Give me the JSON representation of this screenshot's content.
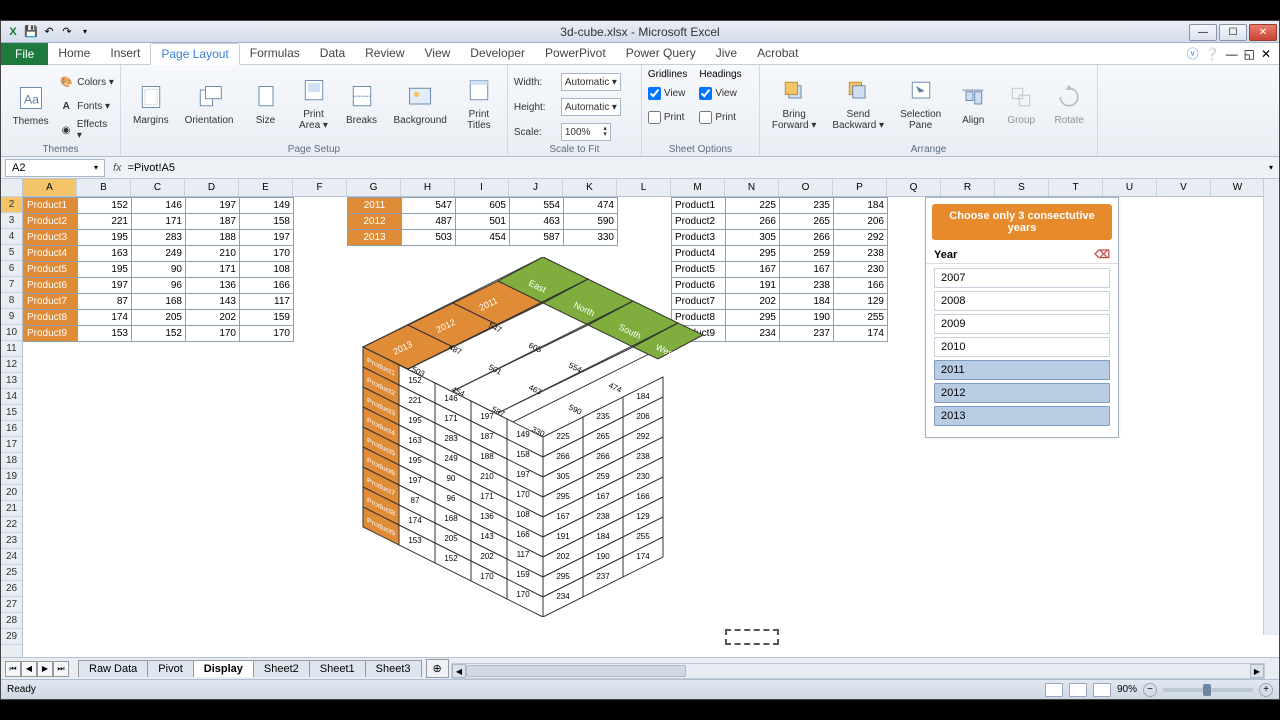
{
  "title": "3d-cube.xlsx - Microsoft Excel",
  "qat": {
    "save": "💾",
    "undo": "↶",
    "redo": "↷"
  },
  "menu": {
    "file": "File",
    "tabs": [
      "Home",
      "Insert",
      "Page Layout",
      "Formulas",
      "Data",
      "Review",
      "View",
      "Developer",
      "PowerPivot",
      "Power Query",
      "Jive",
      "Acrobat"
    ],
    "active": 2
  },
  "ribbon": {
    "themes": {
      "label": "Themes",
      "themes": "Themes",
      "colors": "Colors ▾",
      "fonts": "Fonts ▾",
      "effects": "Effects ▾"
    },
    "pagesetup": {
      "label": "Page Setup",
      "margins": "Margins",
      "orientation": "Orientation",
      "size": "Size",
      "printarea": "Print\nArea ▾",
      "breaks": "Breaks",
      "background": "Background",
      "printtitles": "Print\nTitles"
    },
    "scale": {
      "label": "Scale to Fit",
      "width": "Width:",
      "height": "Height:",
      "scale": "Scale:",
      "auto": "Automatic",
      "pct": "100%"
    },
    "sheetopts": {
      "label": "Sheet Options",
      "gridlines": "Gridlines",
      "headings": "Headings",
      "view": "View",
      "print": "Print",
      "g_view": true,
      "g_print": false,
      "h_view": true,
      "h_print": false
    },
    "arrange": {
      "label": "Arrange",
      "fwd": "Bring\nForward ▾",
      "back": "Send\nBackward ▾",
      "pane": "Selection\nPane",
      "align": "Align",
      "group": "Group",
      "rotate": "Rotate"
    }
  },
  "namebox": "A2",
  "formula": "=Pivot!A5",
  "columns": [
    "A",
    "B",
    "C",
    "D",
    "E",
    "F",
    "G",
    "H",
    "I",
    "J",
    "K",
    "L",
    "M",
    "N",
    "O",
    "P",
    "Q",
    "R",
    "S",
    "T",
    "U",
    "V",
    "W"
  ],
  "rows": [
    "2",
    "3",
    "4",
    "5",
    "6",
    "7",
    "8",
    "9",
    "10",
    "11",
    "12",
    "13",
    "14",
    "15",
    "16",
    "17",
    "18",
    "19",
    "20",
    "21",
    "22",
    "23",
    "24",
    "25",
    "26",
    "27",
    "28",
    "29"
  ],
  "table1": {
    "rows": [
      {
        "p": "Product1",
        "v": [
          152,
          146,
          197,
          149
        ]
      },
      {
        "p": "Product2",
        "v": [
          221,
          171,
          187,
          158
        ]
      },
      {
        "p": "Product3",
        "v": [
          195,
          283,
          188,
          197
        ]
      },
      {
        "p": "Product4",
        "v": [
          163,
          249,
          210,
          170
        ]
      },
      {
        "p": "Product5",
        "v": [
          195,
          90,
          171,
          108
        ]
      },
      {
        "p": "Product6",
        "v": [
          197,
          96,
          136,
          166
        ]
      },
      {
        "p": "Product7",
        "v": [
          87,
          168,
          143,
          117
        ]
      },
      {
        "p": "Product8",
        "v": [
          174,
          205,
          202,
          159
        ]
      },
      {
        "p": "Product9",
        "v": [
          153,
          152,
          170,
          170
        ]
      }
    ]
  },
  "table2": {
    "rows": [
      {
        "y": "2011",
        "v": [
          547,
          605,
          554,
          474
        ]
      },
      {
        "y": "2012",
        "v": [
          487,
          501,
          463,
          590
        ]
      },
      {
        "y": "2013",
        "v": [
          503,
          454,
          587,
          330
        ]
      }
    ]
  },
  "table3": {
    "rows": [
      {
        "p": "Product1",
        "v": [
          225,
          235,
          184
        ]
      },
      {
        "p": "Product2",
        "v": [
          266,
          265,
          206
        ]
      },
      {
        "p": "Product3",
        "v": [
          305,
          266,
          292
        ]
      },
      {
        "p": "Product4",
        "v": [
          295,
          259,
          238
        ]
      },
      {
        "p": "Product5",
        "v": [
          167,
          167,
          230
        ]
      },
      {
        "p": "Product6",
        "v": [
          191,
          238,
          166
        ]
      },
      {
        "p": "Product7",
        "v": [
          202,
          184,
          129
        ]
      },
      {
        "p": "Product8",
        "v": [
          295,
          190,
          255
        ]
      },
      {
        "p": "Product9",
        "v": [
          234,
          237,
          174
        ]
      }
    ]
  },
  "slicer": {
    "banner": "Choose only 3 consectutive years",
    "title": "Year",
    "items": [
      {
        "y": "2007",
        "sel": false
      },
      {
        "y": "2008",
        "sel": false
      },
      {
        "y": "2009",
        "sel": false
      },
      {
        "y": "2010",
        "sel": false
      },
      {
        "y": "2011",
        "sel": true
      },
      {
        "y": "2012",
        "sel": true
      },
      {
        "y": "2013",
        "sel": true
      }
    ]
  },
  "cube_years": [
    "2011",
    "2012",
    "2013"
  ],
  "cube_regions": [
    "East",
    "North",
    "South",
    "West"
  ],
  "sheets": {
    "tabs": [
      "Raw Data",
      "Pivot",
      "Display",
      "Sheet2",
      "Sheet1",
      "Sheet3"
    ],
    "active": 2
  },
  "status": {
    "ready": "Ready",
    "zoom": "90%"
  }
}
